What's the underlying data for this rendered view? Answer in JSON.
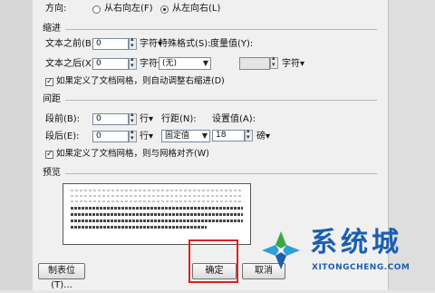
{
  "direction": {
    "label": "方向:",
    "option_rtl": "从右向左(F)",
    "option_ltr": "从左向右(L)",
    "selected": "ltr"
  },
  "indent": {
    "section_title": "缩进",
    "before_label": "文本之前(B):",
    "before_value": "0",
    "before_unit": "字符▾",
    "after_label": "文本之后(X):",
    "after_value": "0",
    "after_unit": "字符▾",
    "special_label": "特殊格式(S):",
    "special_value": "(无)",
    "measure_label": "度量值(Y):",
    "measure_value": "",
    "measure_unit": "字符▾",
    "grid_check_label": "如果定义了文档网格，则自动调整右缩进(D)",
    "grid_checked": true
  },
  "spacing": {
    "section_title": "间距",
    "before_label": "段前(B):",
    "before_value": "0",
    "before_unit": "行▾",
    "after_label": "段后(E):",
    "after_value": "0",
    "after_unit": "行▾",
    "line_label": "行距(N):",
    "line_value": "固定值",
    "setting_label": "设置值(A):",
    "setting_value": "18",
    "setting_unit": "磅▾",
    "grid_check_label": "如果定义了文档网格，则与网格对齐(W)",
    "grid_checked": true
  },
  "preview": {
    "section_title": "预览"
  },
  "footer": {
    "tabs_button": "制表位(T)...",
    "ok_button": "确定",
    "cancel_button": "取消"
  },
  "watermark": {
    "brand_cn": "系统城",
    "brand_url": "XITONGCHENG.COM",
    "colors": {
      "blue": "#1c5fae",
      "green": "#39a845",
      "cyan": "#2f9fd6"
    }
  },
  "colors": {
    "dialog_bg": "#f0f0f0",
    "highlight_border": "#e02020"
  }
}
